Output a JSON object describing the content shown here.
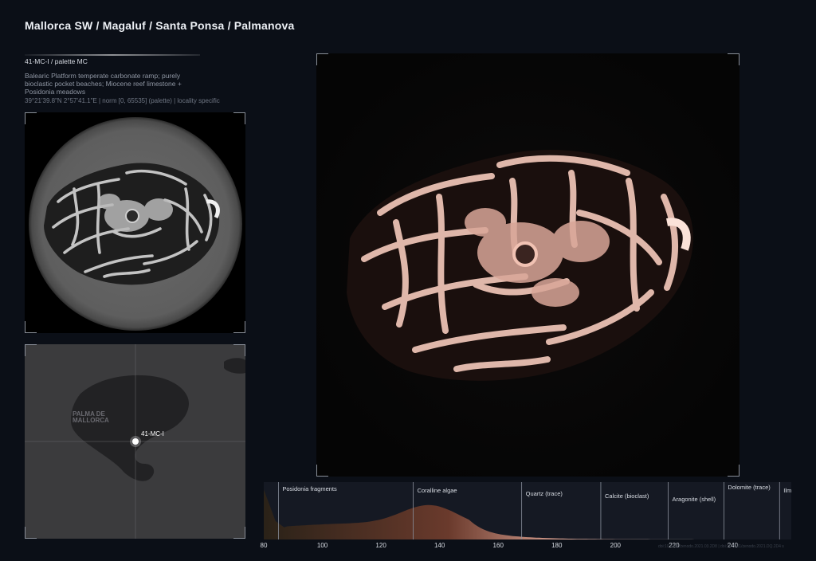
{
  "title": "Mallorca SW / Magaluf / Santa Ponsa / Palmanova",
  "sample": {
    "id_line": "41-MC-I  /  palette MC",
    "description": "Balearic Platform temperate carbonate ramp; purely bioclastic pocket beaches; Miocene reef limestone + Posidonia meadows",
    "coords_line": "39°21'39.8\"N 2°57'41.1\"E  |  norm [0, 65535] (palette)  |  locality specific"
  },
  "map": {
    "place_label_1": "PALMA DE",
    "place_label_2": "MALLORCA",
    "marker_label": "41-MC-I"
  },
  "histogram": {
    "x_range": [
      80,
      260
    ],
    "ticks": [
      "80",
      "100",
      "120",
      "140",
      "160",
      "180",
      "200",
      "220",
      "240"
    ],
    "tick_values": [
      80,
      100,
      120,
      140,
      160,
      180,
      200,
      220,
      240
    ],
    "phases": [
      {
        "label": "Posidonia fragments",
        "start": 85
      },
      {
        "label": "Coralline algae",
        "start": 131
      },
      {
        "label": "Quartz (trace)",
        "start": 168
      },
      {
        "label": "Calcite (bioclast)",
        "start": 195
      },
      {
        "label": "Aragonite (shell)",
        "start": 218
      },
      {
        "label": "Dolomite (trace)",
        "start": 237
      },
      {
        "label": "Ilmenite",
        "start": 256
      }
    ],
    "peak_value": 137,
    "watermark": "doi:10.5281/zenodo.2021.03.2D8  |  doi:10.5281/zenodo.2021.DQ.2D4 s"
  },
  "colors": {
    "background": "#0b0f17",
    "palette_light": "#f1c2b3",
    "palette_dark": "#6a3a2c"
  }
}
